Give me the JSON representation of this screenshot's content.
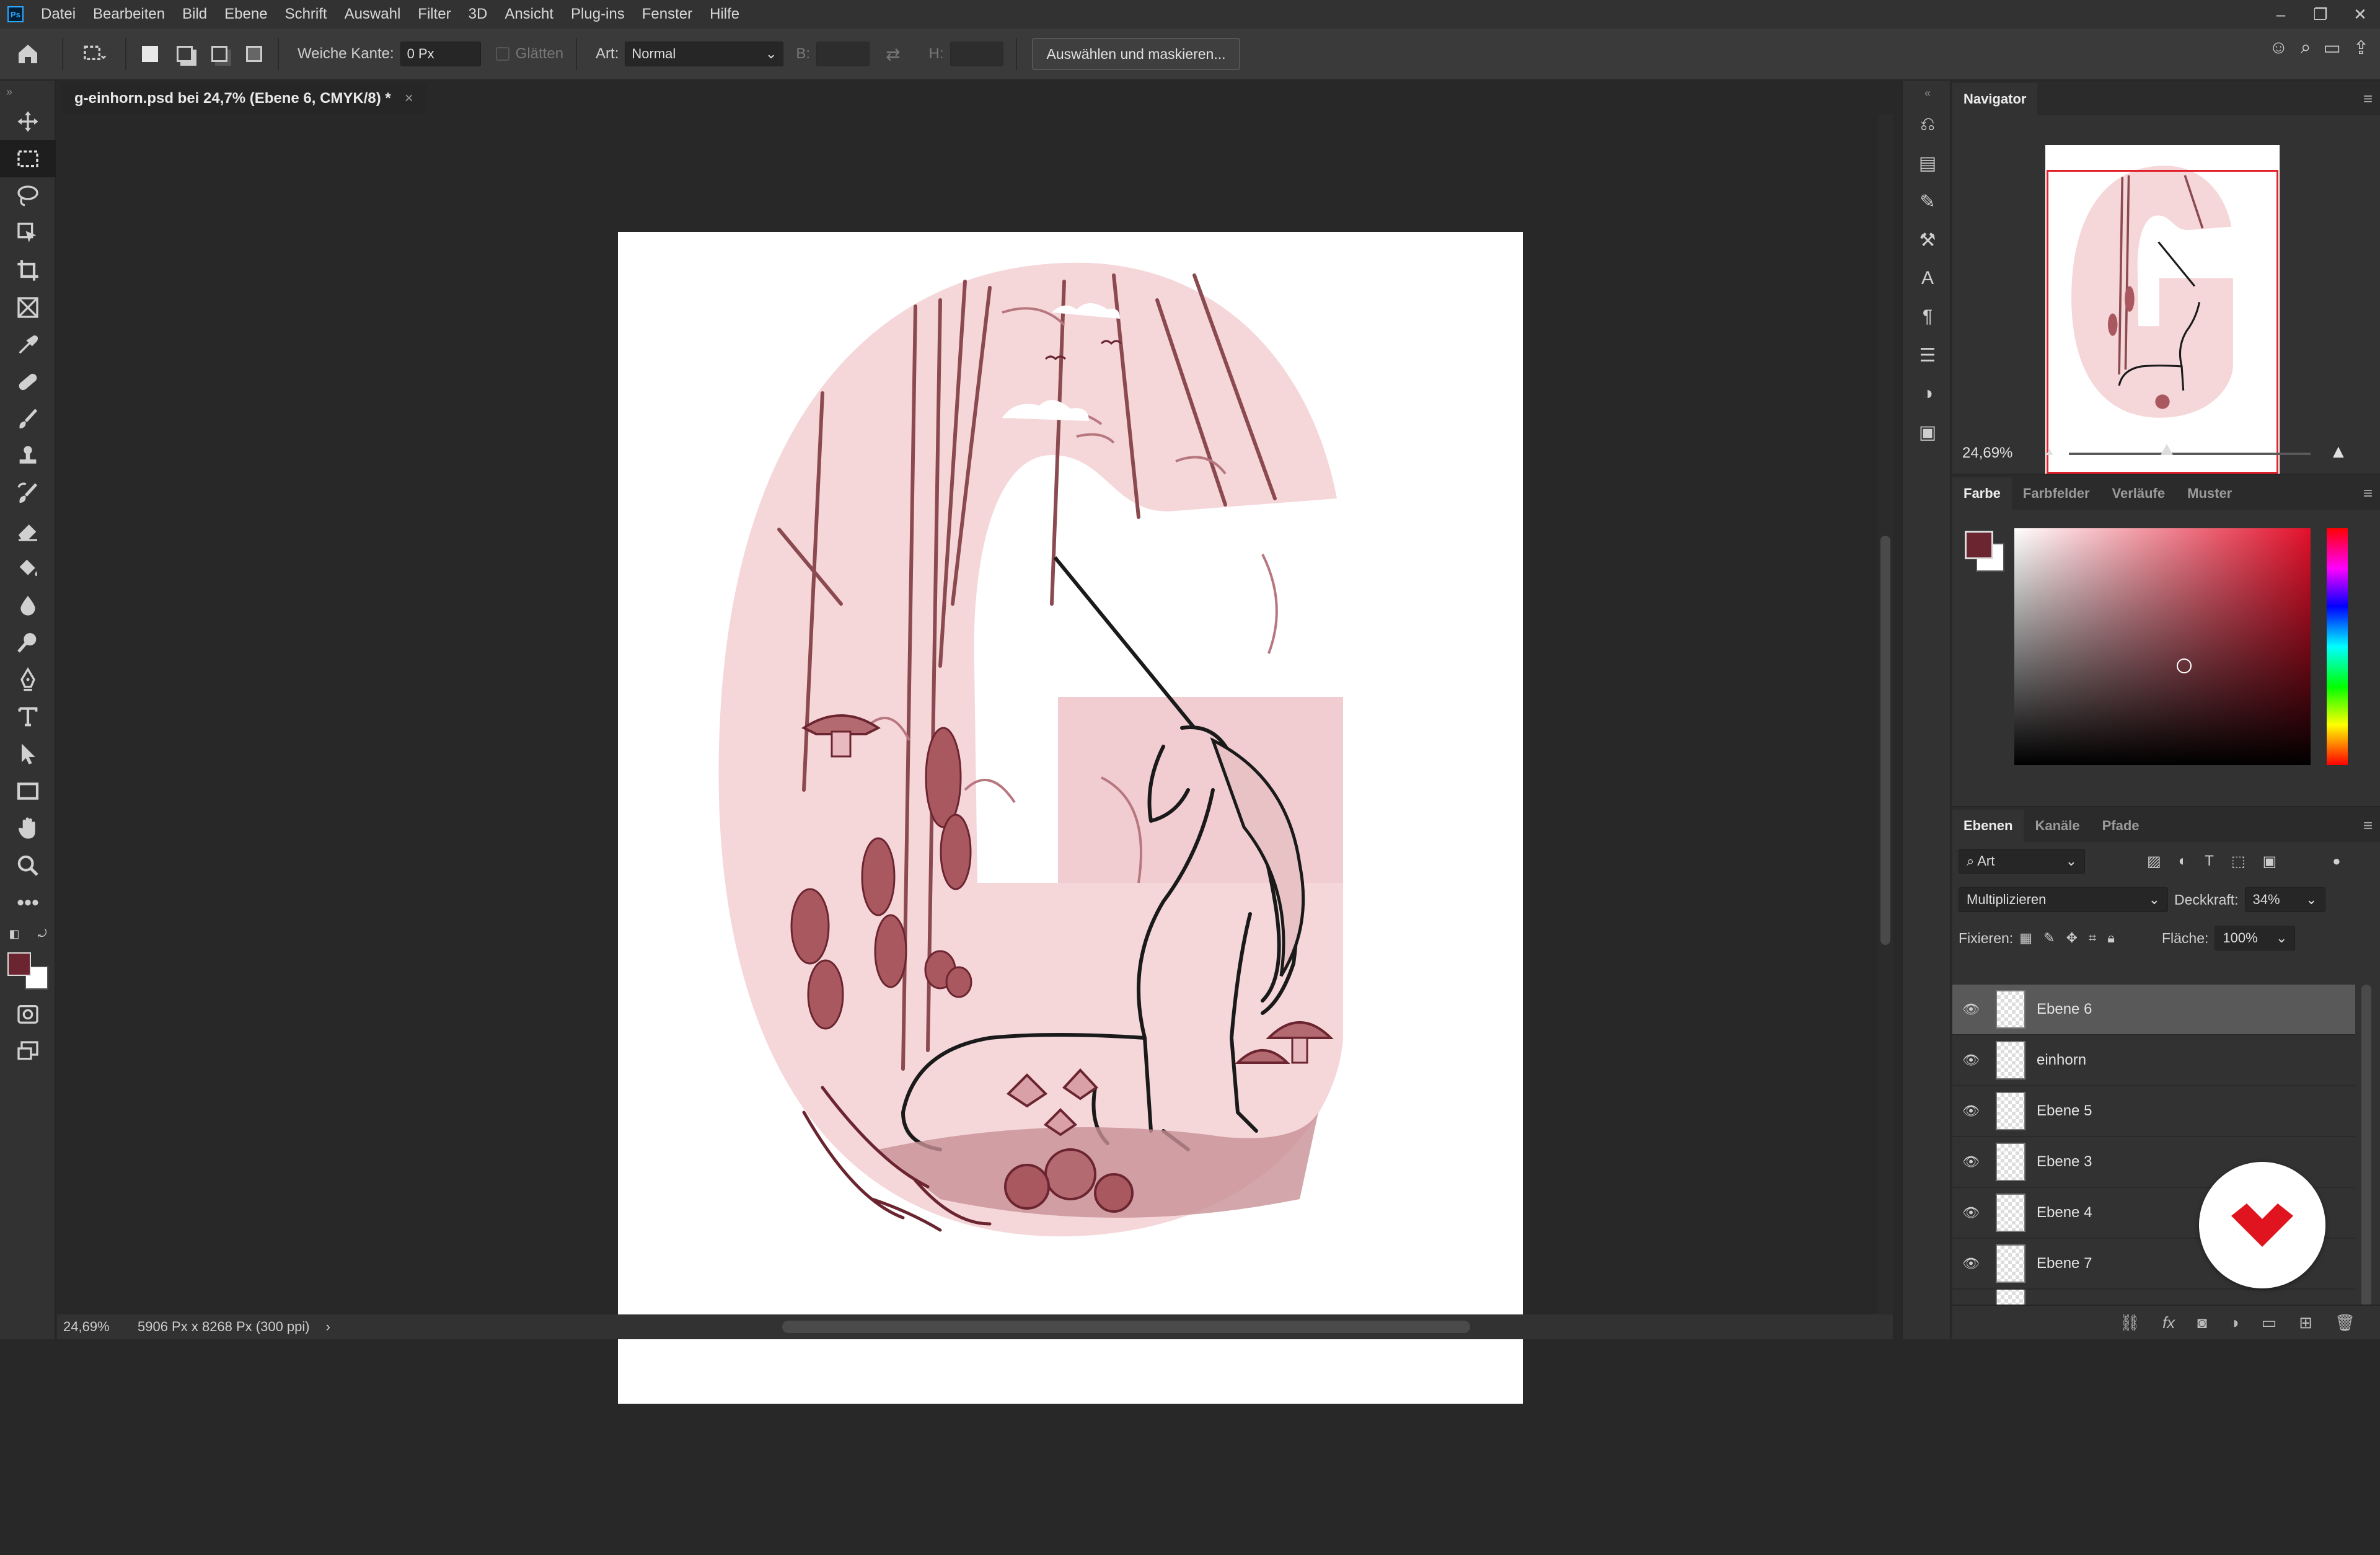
{
  "app": {
    "logo_text": "Ps"
  },
  "menu": [
    "Datei",
    "Bearbeiten",
    "Bild",
    "Ebene",
    "Schrift",
    "Auswahl",
    "Filter",
    "3D",
    "Ansicht",
    "Plug-ins",
    "Fenster",
    "Hilfe"
  ],
  "options": {
    "feather_label": "Weiche Kante:",
    "feather_value": "0 Px",
    "antialias_label": "Glätten",
    "style_label": "Art:",
    "style_value": "Normal",
    "width_label": "B:",
    "height_label": "H:",
    "select_mask_button": "Auswählen und maskieren..."
  },
  "document": {
    "tab_title": "g-einhorn.psd bei 24,7% (Ebene 6, CMYK/8) *",
    "tab_close": "×",
    "art_description_icon": "unicorn-letter-g-illustration"
  },
  "status": {
    "zoom": "24,69%",
    "info": "5906 Px x 8268 Px (300 ppi)",
    "arrow": "›"
  },
  "navigator": {
    "tab": "Navigator",
    "zoom": "24,69%"
  },
  "color": {
    "tabs": [
      "Farbe",
      "Farbfelder",
      "Verläufe",
      "Muster"
    ],
    "foreground": "#6b2530",
    "background": "#ffffff"
  },
  "layers": {
    "tabs": [
      "Ebenen",
      "Kanäle",
      "Pfade"
    ],
    "filter_value": "Art",
    "blend_mode": "Multiplizieren",
    "opacity_label": "Deckkraft:",
    "opacity_value": "34%",
    "lock_label": "Fixieren:",
    "fill_label": "Fläche:",
    "fill_value": "100%",
    "items": [
      {
        "name": "Ebene 6",
        "selected": true
      },
      {
        "name": "einhorn",
        "selected": false
      },
      {
        "name": "Ebene 5",
        "selected": false
      },
      {
        "name": "Ebene 3",
        "selected": false
      },
      {
        "name": "Ebene 4",
        "selected": false
      },
      {
        "name": "Ebene 7",
        "selected": false
      }
    ]
  }
}
